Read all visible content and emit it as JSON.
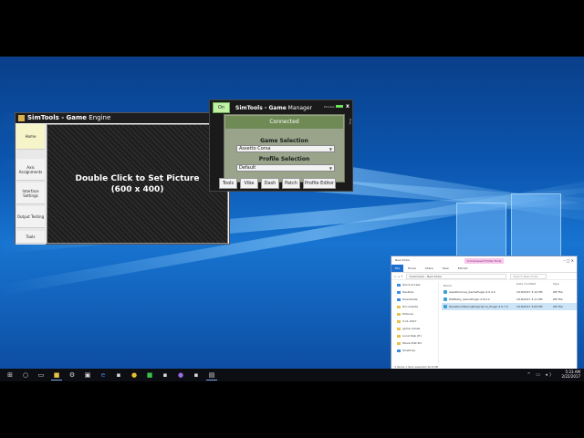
{
  "engine": {
    "title_prefix": "SimTools - ",
    "title_bold": "Game",
    "title_suffix": " Engine",
    "sidebar": [
      "Home",
      "Axis Assignments",
      "Interface Settings",
      "Output Testing",
      "Tools"
    ],
    "picture_line1": "Double Click to Set Picture",
    "picture_line2": "(600 x 400)"
  },
  "manager": {
    "on_label": "On",
    "title_prefix": "SimTools - ",
    "title_bold": "Game",
    "title_suffix": " Manager",
    "status_label": "Process",
    "close": "x",
    "side_label": "Plug",
    "connected": "Connected",
    "game_selection_label": "Game Selection",
    "game_selection_value": "Assetto Corsa",
    "profile_selection_label": "Profile Selection",
    "profile_selection_value": "Default",
    "buttons": [
      "Tools",
      "Vibe",
      "Dash",
      "Patch",
      "Profile Editor"
    ]
  },
  "explorer": {
    "title": "New folder",
    "tool_tab": "Compressed Folder Tools",
    "window_controls": "–  □  ✕",
    "ribbon": [
      "File",
      "Home",
      "Share",
      "View",
      "Extract"
    ],
    "path": "Downloads  ›  New folder",
    "search_placeholder": "Search New folder",
    "nav": [
      "Quick access",
      "Desktop",
      "Downloads",
      "Documents",
      "Pictures",
      "3-11-2017",
      "game review",
      "Local Disk (E:)",
      "Movie Edit Pro",
      "OneDrive"
    ],
    "columns": [
      "Name",
      "Date modified",
      "Type"
    ],
    "files": [
      {
        "name": "AssettoCorsa_GamePlugin.2.0.4.2",
        "date": "2/18/2017 3:10 PM",
        "type": "ZIP File"
      },
      {
        "name": "DiRtRally_GamePlugin.2.8.0.2",
        "date": "2/18/2017 3:11 PM",
        "type": "ZIP File"
      },
      {
        "name": "RaceRoomRacingExperience_Plugin.2.0.7.5",
        "date": "2/18/2017 3:09 PM",
        "type": "ZIP File"
      }
    ],
    "status": "3 items   1 item selected   20.8 KB"
  },
  "taskbar": {
    "time": "5:23 AM",
    "date": "2/22/2017",
    "icons": [
      "start-icon",
      "cortana-icon",
      "task-view-icon",
      "file-explorer-icon",
      "settings-icon",
      "store-icon",
      "edge-icon",
      "chrome-icon",
      "app-icon",
      "app-icon",
      "app-icon",
      "app-icon"
    ]
  },
  "colors": {
    "desktop_blue": "#0b56b0",
    "connected_green": "#6f8a55",
    "on_green": "#bff0a4"
  }
}
